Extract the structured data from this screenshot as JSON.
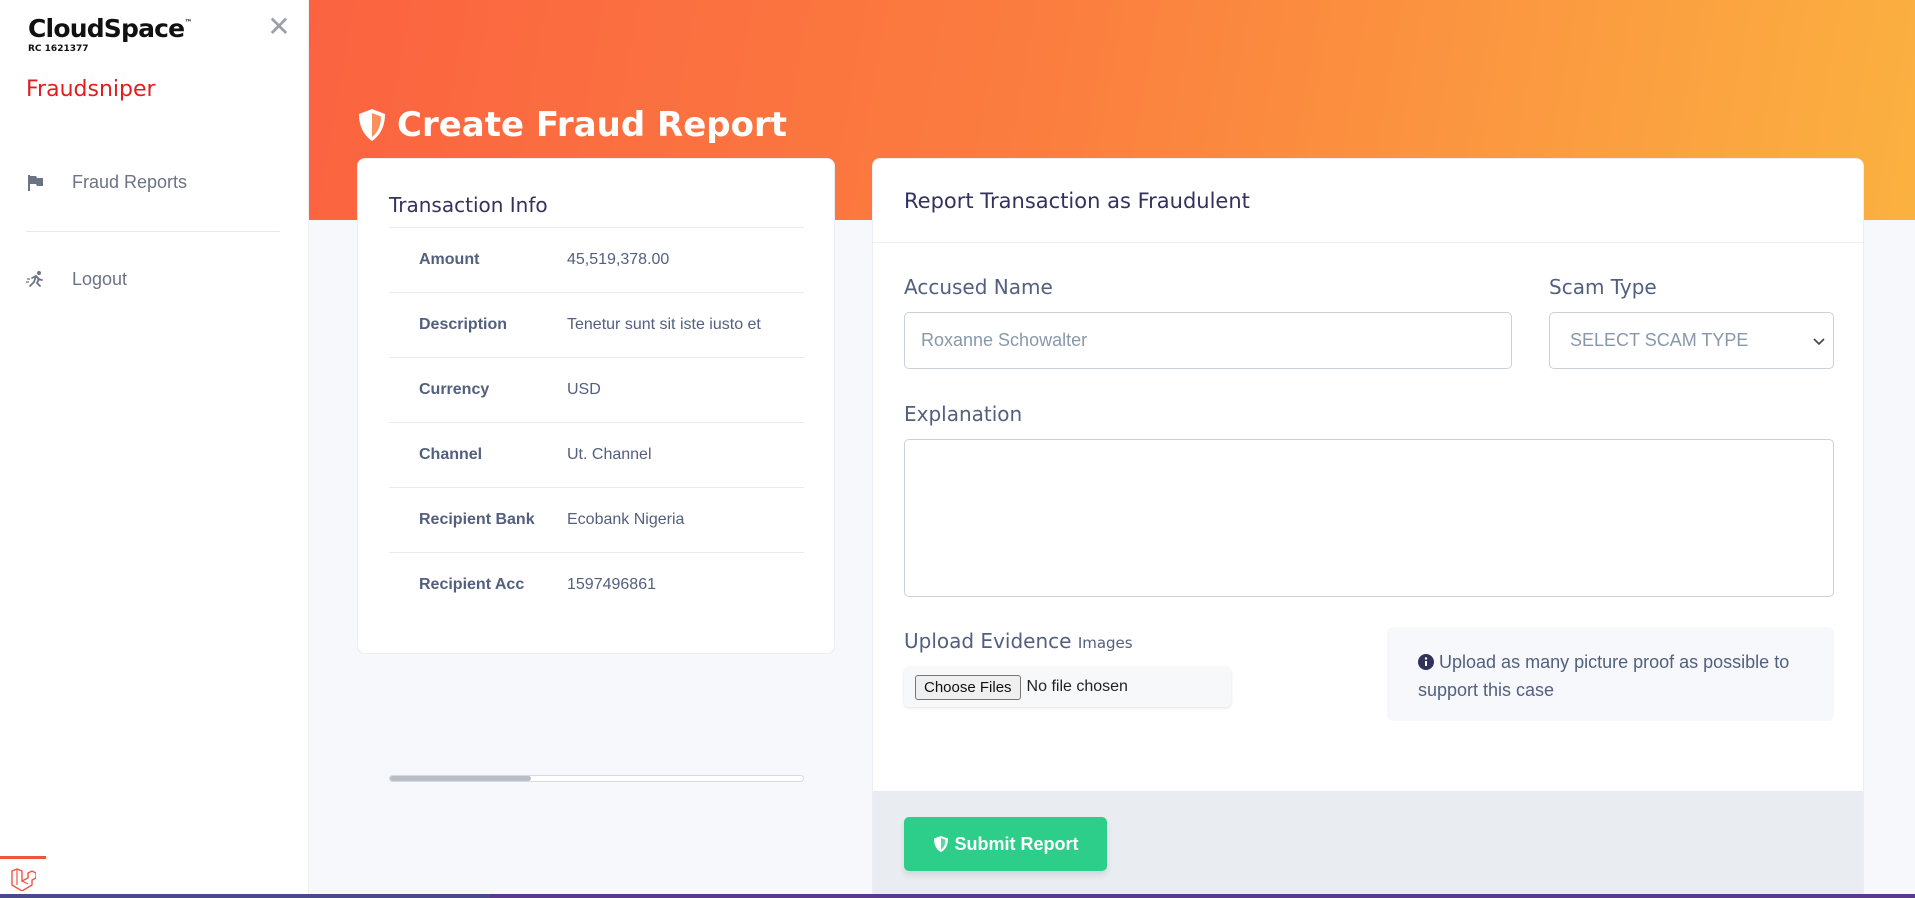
{
  "sidebar": {
    "brand": "CloudSpace",
    "brand_tm": "™",
    "brand_rc": "RC 1621377",
    "app_name": "Fraudsniper",
    "items": [
      {
        "label": "Fraud Reports",
        "icon": "flag-icon"
      },
      {
        "label": "Logout",
        "icon": "running-icon"
      }
    ]
  },
  "header": {
    "title": "Create Fraud Report"
  },
  "transaction": {
    "title": "Transaction Info",
    "rows": [
      {
        "label": "Amount",
        "value": "45,519,378.00"
      },
      {
        "label": "Description",
        "value": "Tenetur sunt sit iste iusto et"
      },
      {
        "label": "Currency",
        "value": "USD"
      },
      {
        "label": "Channel",
        "value": "Ut. Channel"
      },
      {
        "label": "Recipient Bank",
        "value": "Ecobank Nigeria"
      },
      {
        "label": "Recipient Acc",
        "value": "1597496861"
      }
    ]
  },
  "form": {
    "title": "Report Transaction as Fraudulent",
    "accused_label": "Accused Name",
    "accused_value": "Roxanne Schowalter",
    "scam_label": "Scam Type",
    "scam_selected": "SELECT SCAM TYPE",
    "explanation_label": "Explanation",
    "explanation_value": "",
    "upload_label": "Upload Evidence",
    "upload_sublabel": "Images",
    "file_button": "Choose Files",
    "file_status": "No file chosen",
    "note": "Upload as many picture proof as possible to support this case",
    "submit_label": "Submit Report"
  },
  "colors": {
    "accent_orange": "#fb6340",
    "accent_yellow": "#fbb140",
    "brand_red": "#e01e1e",
    "submit_green": "#2dce89"
  }
}
